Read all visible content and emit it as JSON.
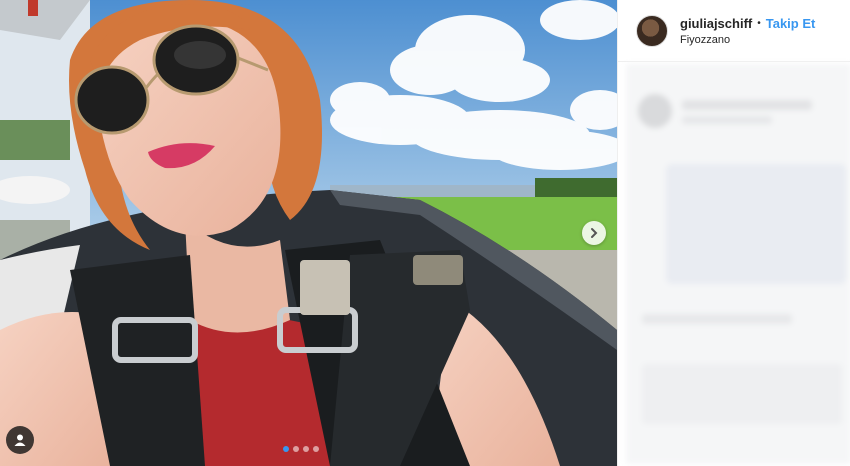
{
  "post": {
    "username": "giuliajschiff",
    "separator": "•",
    "follow_label": "Takip Et",
    "location": "Fiyozzano",
    "carousel": {
      "total_slides": 4,
      "active_index": 0
    }
  },
  "colors": {
    "accent": "#3897f0",
    "text": "#262626",
    "sky": "#6fa7d8",
    "lipstick": "#d63b64",
    "hair": "#d3773c",
    "shirt": "#b42a2e",
    "grass": "#7bbf48"
  },
  "icons": {
    "next": "chevron-right-icon",
    "user_tag": "user-tag-icon"
  }
}
